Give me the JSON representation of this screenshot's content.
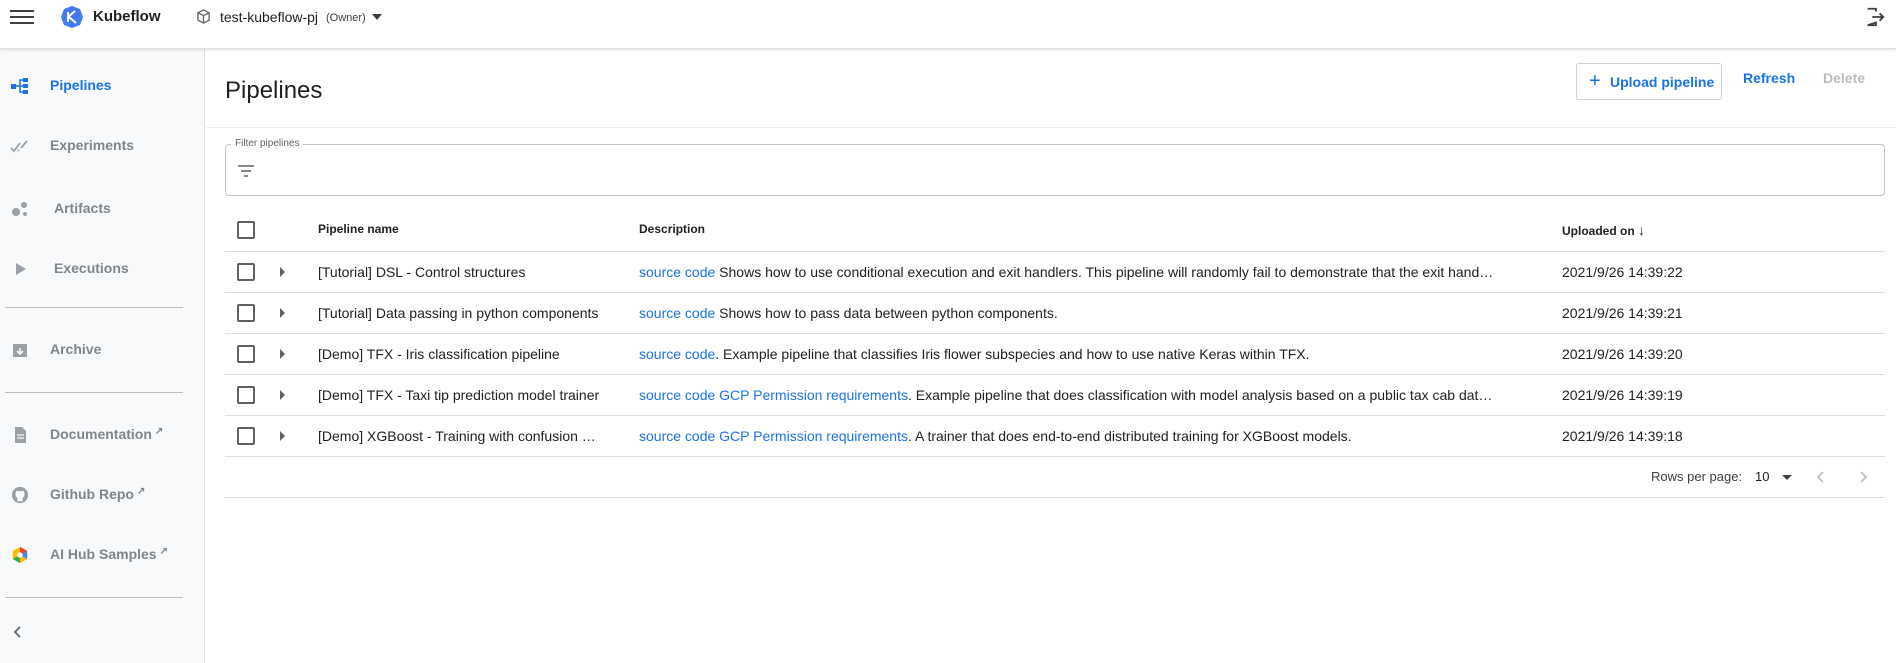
{
  "topbar": {
    "brand": "Kubeflow",
    "namespace": "test-kubeflow-pj",
    "role": "(Owner)"
  },
  "sidebar": {
    "items": [
      {
        "label": "Pipelines",
        "icon": "pipelines-icon",
        "active": true
      },
      {
        "label": "Experiments",
        "icon": "experiments-icon"
      },
      {
        "label": "Artifacts",
        "icon": "artifacts-icon"
      },
      {
        "label": "Executions",
        "icon": "executions-icon"
      },
      {
        "label": "Archive",
        "icon": "archive-icon"
      },
      {
        "label": "Documentation",
        "icon": "documentation-icon",
        "external": true
      },
      {
        "label": "Github Repo",
        "icon": "github-icon",
        "external": true
      },
      {
        "label": "AI Hub Samples",
        "icon": "ai-hub-icon",
        "external": true
      }
    ]
  },
  "page": {
    "title": "Pipelines",
    "upload_label": "Upload pipeline",
    "refresh_label": "Refresh",
    "delete_label": "Delete"
  },
  "filter": {
    "label": "Filter pipelines",
    "value": ""
  },
  "table": {
    "headers": {
      "name": "Pipeline name",
      "description": "Description",
      "uploaded": "Uploaded on"
    },
    "rows": [
      {
        "name": "[Tutorial] DSL - Control structures",
        "link1": "source code",
        "link2": "",
        "desc": " Shows how to use conditional execution and exit handlers. This pipeline will randomly fail to demonstrate that the exit hand…",
        "uploaded": "2021/9/26 14:39:22"
      },
      {
        "name": "[Tutorial] Data passing in python components",
        "link1": "source code",
        "link2": "",
        "desc": " Shows how to pass data between python components.",
        "uploaded": "2021/9/26 14:39:21"
      },
      {
        "name": "[Demo] TFX - Iris classification pipeline",
        "link1": "source code",
        "link2": "",
        "desc": ". Example pipeline that classifies Iris flower subspecies and how to use native Keras within TFX.",
        "uploaded": "2021/9/26 14:39:20"
      },
      {
        "name": "[Demo] TFX - Taxi tip prediction model trainer",
        "link1": "source code",
        "link2": " GCP Permission requirements",
        "desc": ". Example pipeline that does classification with model analysis based on a public tax cab dat…",
        "uploaded": "2021/9/26 14:39:19"
      },
      {
        "name": "[Demo] XGBoost - Training with confusion …",
        "link1": "source code",
        "link2": " GCP Permission requirements",
        "desc": ". A trainer that does end-to-end distributed training for XGBoost models.",
        "uploaded": "2021/9/26 14:39:18"
      }
    ]
  },
  "pagination": {
    "rows_per_page_label": "Rows per page:",
    "rows_per_page": "10"
  },
  "colors": {
    "accent": "#1a73e8",
    "sidebar_bg": "#f8f9fa",
    "muted": "#80868b"
  }
}
